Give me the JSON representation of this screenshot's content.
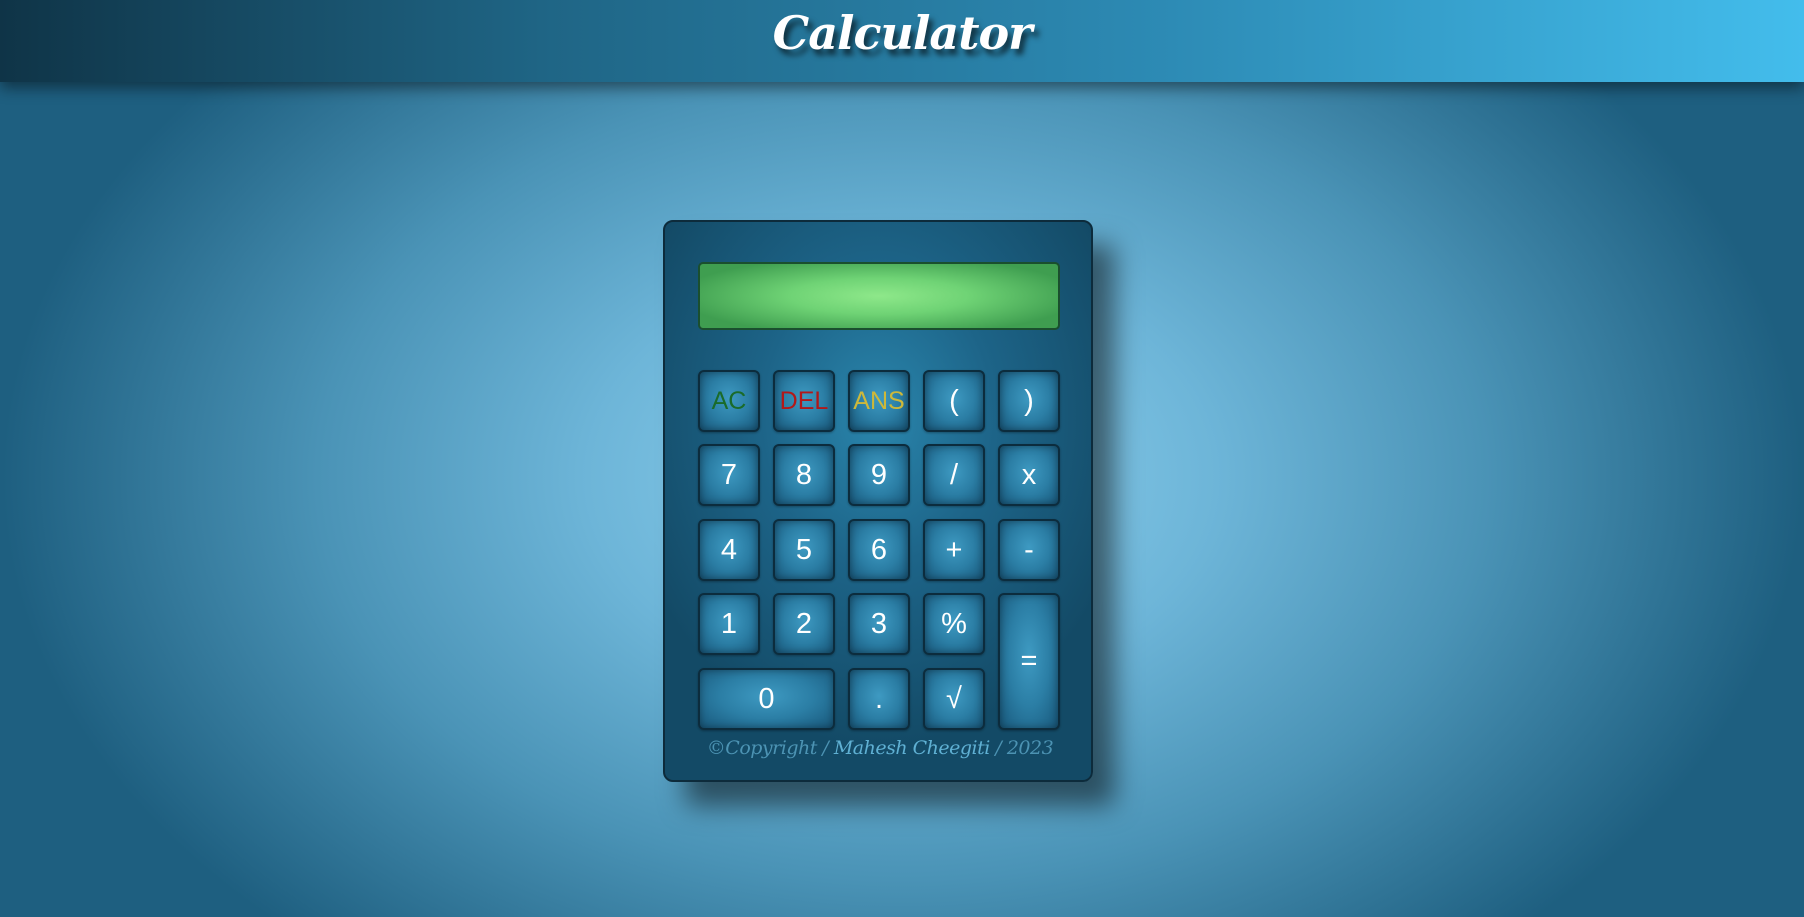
{
  "header": {
    "title": "Calculator"
  },
  "display": {
    "value": ""
  },
  "keys": {
    "ac": "AC",
    "del": "DEL",
    "ans": "ANS",
    "lparen": "(",
    "rparen": ")",
    "k7": "7",
    "k8": "8",
    "k9": "9",
    "divide": "/",
    "multiply": "x",
    "k4": "4",
    "k5": "5",
    "k6": "6",
    "plus": "+",
    "minus": "-",
    "k1": "1",
    "k2": "2",
    "k3": "3",
    "percent": "%",
    "equals": "=",
    "k0": "0",
    "dot": ".",
    "sqrt": "√"
  },
  "footer": {
    "prefix": "©Copyright / ",
    "author": "Mahesh Cheegiti",
    "suffix": " / 2023"
  },
  "colors": {
    "ac": "#1a6b2a",
    "del": "#b21818",
    "ans": "#cdb83a",
    "display": "#7ddc7f"
  }
}
